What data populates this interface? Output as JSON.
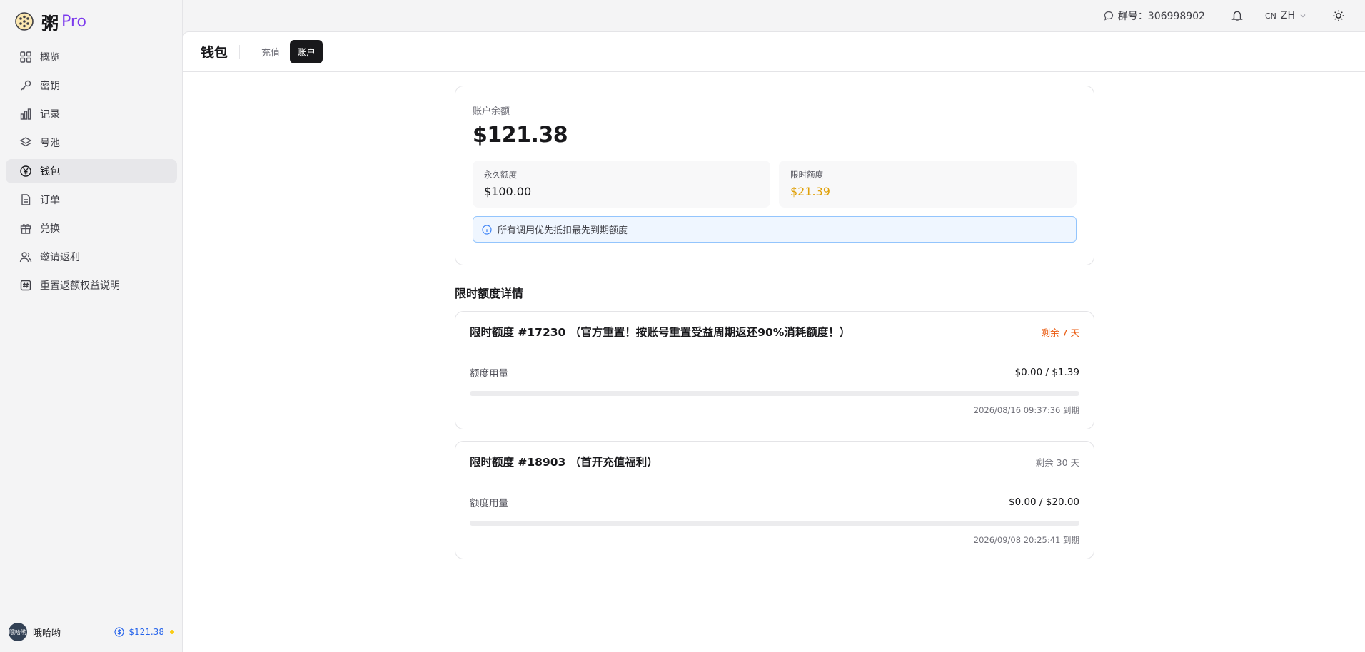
{
  "app": {
    "name": "粥",
    "badge": "Pro"
  },
  "sidebar": {
    "items": [
      {
        "label": "概览",
        "icon": "grid-icon"
      },
      {
        "label": "密钥",
        "icon": "key-icon"
      },
      {
        "label": "记录",
        "icon": "bar-chart-icon"
      },
      {
        "label": "号池",
        "icon": "layers-icon"
      },
      {
        "label": "钱包",
        "icon": "yen-icon",
        "active": true
      },
      {
        "label": "订单",
        "icon": "file-icon"
      },
      {
        "label": "兑换",
        "icon": "gift-icon"
      },
      {
        "label": "邀请返利",
        "icon": "users-icon"
      },
      {
        "label": "重置返额权益说明",
        "icon": "hash-icon"
      }
    ],
    "user": {
      "name": "哦哈哟",
      "avatar_text": "哦哈哟",
      "balance": "$121.38"
    }
  },
  "topbar": {
    "group_label": "群号：306998902",
    "lang_code": "CN",
    "lang": "ZH"
  },
  "header": {
    "title": "钱包",
    "tabs": [
      {
        "label": "充值",
        "active": false
      },
      {
        "label": "账户",
        "active": true
      }
    ]
  },
  "balance": {
    "label": "账户余额",
    "amount": "$121.38",
    "permanent_label": "永久额度",
    "permanent_value": "$100.00",
    "limited_label": "限时额度",
    "limited_value": "$21.39",
    "info": "所有调用优先抵扣最先到期额度"
  },
  "limited": {
    "section_title": "限时额度详情",
    "items": [
      {
        "title": "限时额度 #17230 （官方重置！按账号重置受益周期返还90%消耗额度！）",
        "remaining": "剩余 7 天",
        "usage_label": "额度用量",
        "usage_value": "$0.00 / $1.39",
        "used_fraction": 0,
        "expire": "2026/08/16 09:37:36 到期"
      },
      {
        "title": "限时额度 #18903 （首开充值福利）",
        "remaining": "剩余 30 天",
        "usage_label": "额度用量",
        "usage_value": "$0.00 / $20.00",
        "used_fraction": 0,
        "expire": "2026/09/08 20:25:41 到期"
      }
    ]
  },
  "colors": {
    "accent": "#7c3aed",
    "warn": "#ea580c",
    "amber": "#e0a008",
    "info_border": "#93c5fd"
  }
}
